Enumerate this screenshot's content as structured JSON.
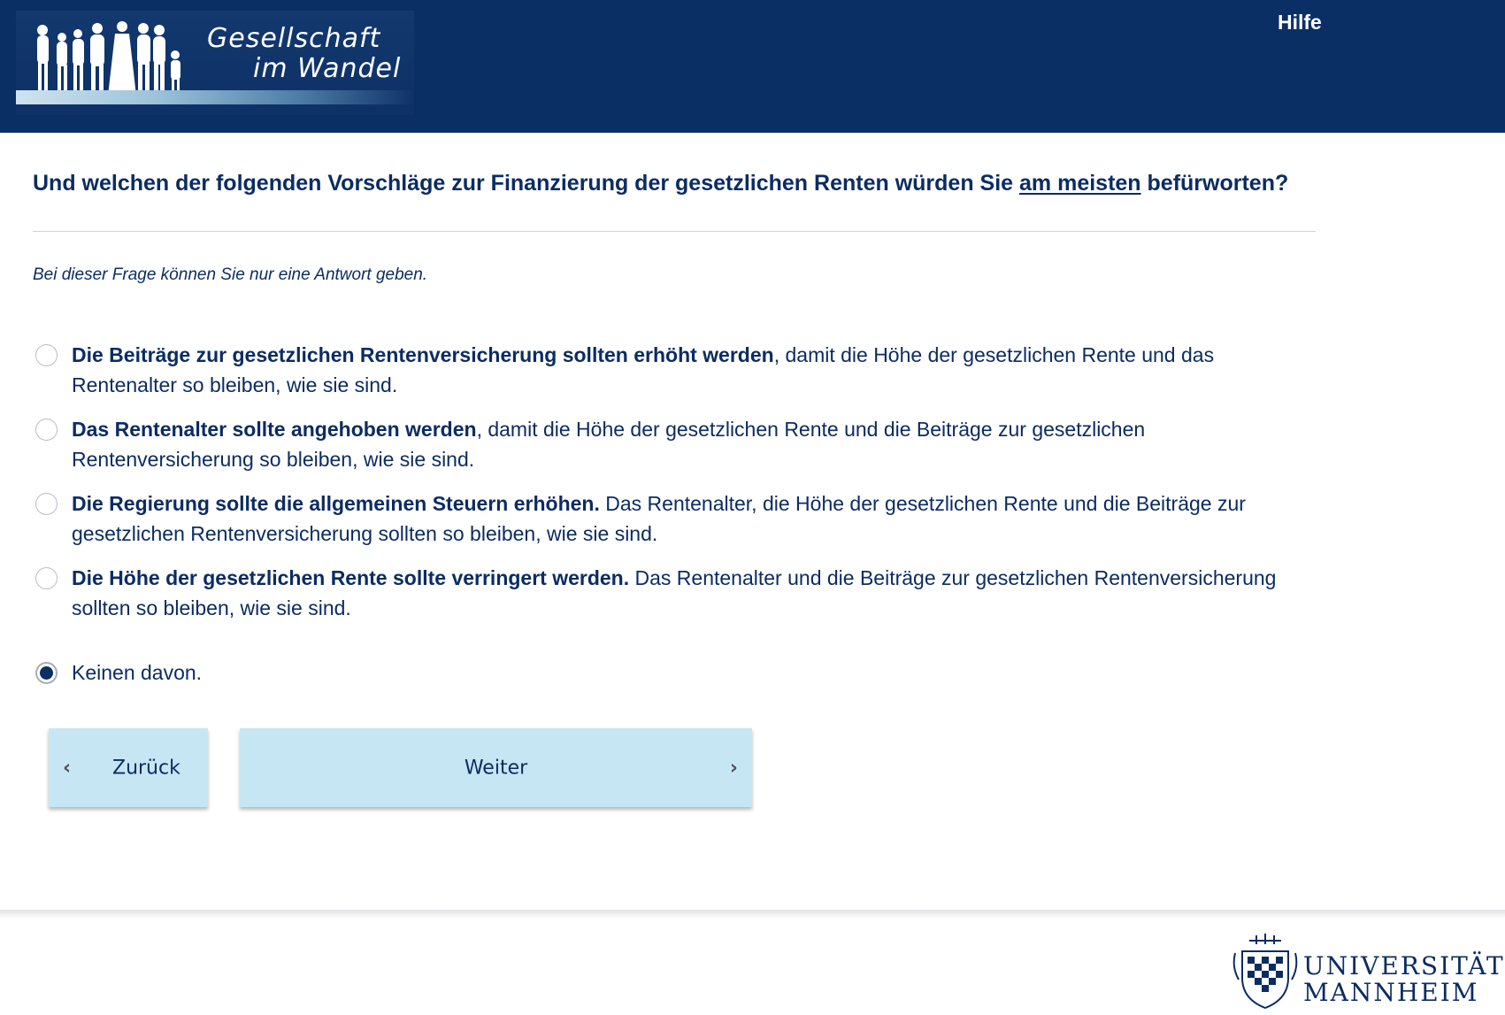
{
  "header": {
    "logo_line1": "Gesellschaft",
    "logo_line2": "im Wandel",
    "help_label": "Hilfe"
  },
  "question": {
    "text_before": "Und welchen der folgenden Vorschläge zur Finanzierung der gesetzlichen Renten würden Sie ",
    "emphasis": "am meisten",
    "text_after": " befürworten?"
  },
  "instruction": "Bei dieser Frage können Sie nur eine Antwort geben.",
  "options": [
    {
      "bold": "Die Beiträge zur gesetzlichen Rentenversicherung sollten erhöht werden",
      "rest": ", damit die Höhe der gesetzlichen Rente und das Rentenalter so bleiben, wie sie sind.",
      "selected": false
    },
    {
      "bold": "Das Rentenalter sollte angehoben werden",
      "rest": ", damit die Höhe der gesetzlichen Rente und die Beiträge zur gesetzlichen Rentenversicherung so bleiben, wie sie sind.",
      "selected": false
    },
    {
      "bold": "Die Regierung sollte die allgemeinen Steuern erhöhen.",
      "rest": " Das Rentenalter, die Höhe der gesetzlichen Rente und die Beiträge zur gesetzlichen Rentenversicherung sollten so bleiben, wie sie sind.",
      "selected": false
    },
    {
      "bold": "Die Höhe der gesetzlichen Rente sollte verringert werden.",
      "rest": " Das Rentenalter und die Beiträge zur gesetzlichen Rentenversicherung sollten so bleiben, wie sie sind.",
      "selected": false
    },
    {
      "bold": "",
      "rest": "Keinen davon.",
      "selected": true
    }
  ],
  "buttons": {
    "back_label": "Zurück",
    "next_label": "Weiter",
    "back_icon": "chevron-left-icon",
    "next_icon": "chevron-right-icon"
  },
  "footer": {
    "uni_line1": "UNIVERSITÄT",
    "uni_line2": "MANNHEIM"
  },
  "colors": {
    "header_bg": "#0a2f64",
    "text": "#0b2c63",
    "button_bg": "#c6e6f4"
  }
}
